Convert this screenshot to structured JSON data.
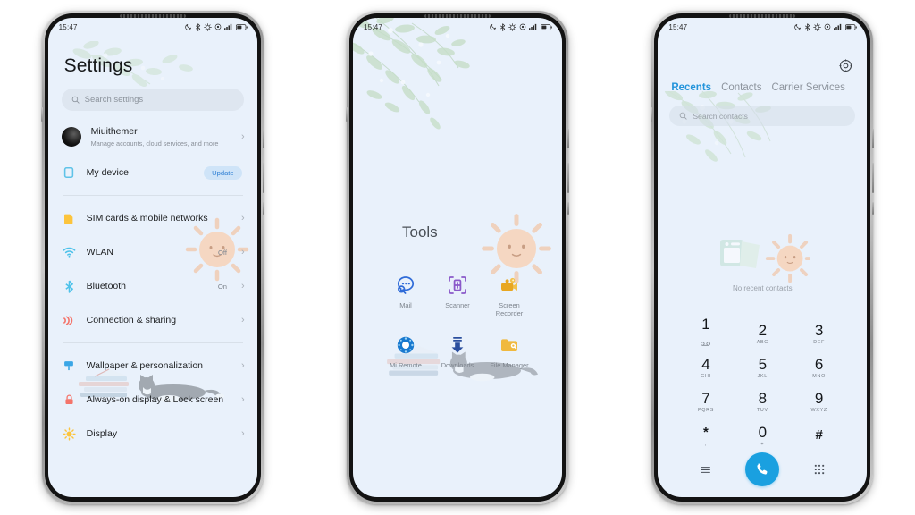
{
  "theme": {
    "screen_bg": "#e9f1fb",
    "accent_blue": "#2394db",
    "call_button": "#1aa0e0",
    "muted_text": "#8a9099",
    "page_bg": "#ffffff"
  },
  "status_bar": {
    "time": "15:47",
    "icons": [
      "dnd-moon-icon",
      "bluetooth-icon",
      "app-vitals-icon",
      "location-icon",
      "signal-bars-icon",
      "battery-icon"
    ]
  },
  "phone1_settings": {
    "title": "Settings",
    "search": {
      "placeholder": "Search settings",
      "icon": "search-icon"
    },
    "account": {
      "name": "Miuithemer",
      "subtitle": "Manage accounts, cloud services, and more",
      "avatar": "avatar",
      "chevron": "›"
    },
    "device": {
      "label": "My device",
      "badge": "Update",
      "icon": "device-icon"
    },
    "items": [
      {
        "label": "SIM cards & mobile networks",
        "value": "",
        "icon": "sim-card-icon",
        "chevron": "›"
      },
      {
        "label": "WLAN",
        "value": "Off",
        "icon": "wifi-icon",
        "chevron": "›"
      },
      {
        "label": "Bluetooth",
        "value": "On",
        "icon": "bluetooth-icon",
        "chevron": "›"
      },
      {
        "label": "Connection & sharing",
        "value": "",
        "icon": "connection-sharing-icon",
        "chevron": "›"
      }
    ],
    "items2": [
      {
        "label": "Wallpaper & personalization",
        "value": "",
        "icon": "wallpaper-icon",
        "chevron": "›"
      },
      {
        "label": "Always-on display & Lock screen",
        "value": "",
        "icon": "lock-icon",
        "chevron": "›"
      },
      {
        "label": "Display",
        "value": "",
        "icon": "brightness-icon",
        "chevron": "›"
      }
    ]
  },
  "phone2_tools": {
    "title": "Tools",
    "apps": [
      {
        "label": "Mail",
        "icon": "mail-icon"
      },
      {
        "label": "Scanner",
        "icon": "scanner-icon"
      },
      {
        "label": "Screen Recorder",
        "icon": "screen-recorder-icon"
      },
      {
        "label": "Mi Remote",
        "icon": "mi-remote-icon"
      },
      {
        "label": "Downloads",
        "icon": "downloads-icon"
      },
      {
        "label": "File Manager",
        "icon": "file-manager-icon"
      }
    ]
  },
  "phone3_dialer": {
    "settings_icon": "gear-icon",
    "tabs": [
      {
        "label": "Recents",
        "active": true
      },
      {
        "label": "Contacts",
        "active": false
      },
      {
        "label": "Carrier Services",
        "active": false
      }
    ],
    "search": {
      "placeholder": "Search contacts",
      "icon": "search-icon"
    },
    "empty_state": {
      "text": "No recent contacts",
      "icon": "no-contacts-illustration"
    },
    "keys": [
      {
        "num": "1",
        "sub": "∞",
        "voicemail": true
      },
      {
        "num": "2",
        "sub": "ABC",
        "voicemail": false
      },
      {
        "num": "3",
        "sub": "DEF",
        "voicemail": false
      },
      {
        "num": "4",
        "sub": "GHI",
        "voicemail": false
      },
      {
        "num": "5",
        "sub": "JKL",
        "voicemail": false
      },
      {
        "num": "6",
        "sub": "MNO",
        "voicemail": false
      },
      {
        "num": "7",
        "sub": "PQRS",
        "voicemail": false
      },
      {
        "num": "8",
        "sub": "TUV",
        "voicemail": false
      },
      {
        "num": "9",
        "sub": "WXYZ",
        "voicemail": false
      },
      {
        "num": "*",
        "sub": ",",
        "voicemail": false
      },
      {
        "num": "0",
        "sub": "+",
        "voicemail": false
      },
      {
        "num": "#",
        "sub": "",
        "voicemail": false
      }
    ],
    "actions": {
      "menu_icon": "menu-lines-icon",
      "call_icon": "phone-handset-icon",
      "keypad_icon": "keypad-dots-icon"
    }
  }
}
